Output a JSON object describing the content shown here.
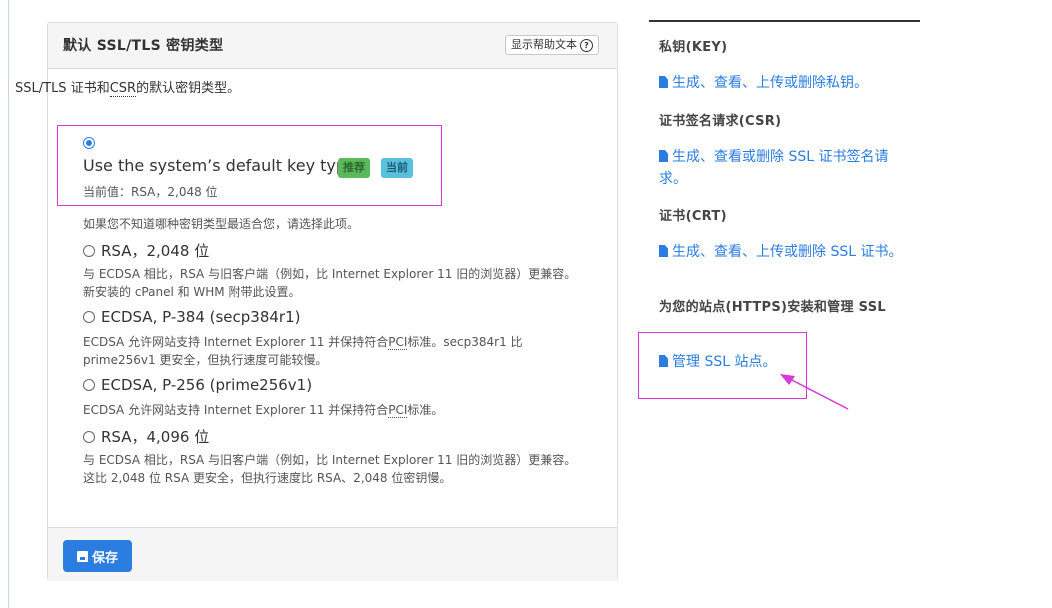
{
  "panel": {
    "title": "默认 SSL/TLS 密钥类型",
    "help_button": "显示帮助文本",
    "description_pre": "SSL/TLS 证书和",
    "description_abbr": "CSR",
    "description_post": "的默认密钥类型。",
    "save_label": "保存"
  },
  "options": {
    "default": {
      "label": "Use the system’s default key type.",
      "badge_recommended": "推荐",
      "badge_current": "当前",
      "current_value": "当前值：RSA，2,048 位",
      "help": "如果您不知道哪种密钥类型最适合您，请选择此项。"
    },
    "rsa2048": {
      "label": "RSA，2,048 位",
      "help_line1": "与 ECDSA 相比，RSA 与旧客户端（例如，比 Internet Explorer 11 旧的浏览器）更兼容。",
      "help_line2": "新安装的 cPanel 和 WHM 附带此设置。"
    },
    "ecdsa384": {
      "label": "ECDSA, P-384 (secp384r1)",
      "help_line1_pre": "ECDSA 允许网站支持 Internet Explorer 11 并保持符合",
      "help_pci": "PCI",
      "help_line1_post": "标准。secp384r1 比",
      "help_line2": "prime256v1 更安全，但执行速度可能较慢。"
    },
    "ecdsa256": {
      "label": "ECDSA, P-256 (prime256v1)",
      "help_pre": "ECDSA 允许网站支持 Internet Explorer 11 并保持符合",
      "help_pci": "PCI",
      "help_post": "标准。"
    },
    "rsa4096": {
      "label": "RSA，4,096 位",
      "help_line1": "与 ECDSA 相比，RSA 与旧客户端（例如，比 Internet Explorer 11 旧的浏览器）更兼容。",
      "help_line2": "这比 2,048 位 RSA 更安全，但执行速度比 RSA、2,048 位密钥慢。"
    }
  },
  "sidebar": {
    "key_heading": "私钥(KEY)",
    "key_link": "生成、查看、上传或删除私钥。",
    "csr_heading": "证书签名请求(CSR)",
    "csr_link": "生成、查看或删除 SSL 证书签名请求。",
    "crt_heading": "证书(CRT)",
    "crt_link": "生成、查看、上传或删除 SSL 证书。",
    "sites_heading": "为您的站点(HTTPS)安装和管理 SSL",
    "sites_link": "管理 SSL 站点。"
  },
  "colors": {
    "accent": "#2b7de1",
    "highlight": "#d33ad8",
    "badge_recommended": "#5cb85c",
    "badge_current": "#5bc0de"
  }
}
